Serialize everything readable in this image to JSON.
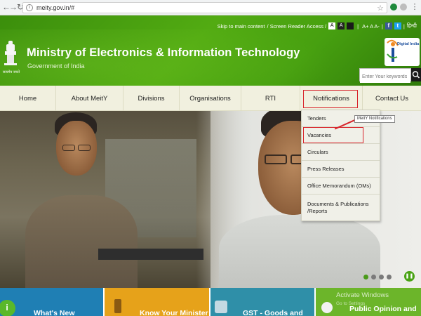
{
  "browser": {
    "url": "meity.gov.in/#",
    "back_icon": "back-arrow-icon",
    "forward_icon": "forward-arrow-icon",
    "reload_icon": "reload-icon"
  },
  "utility": {
    "skip_link": "Skip to main content",
    "screen_reader": "/ Screen Reader Access /",
    "contrast_a_light": "A",
    "contrast_a_dark": "A",
    "font_sizes": "A+ A A-",
    "hindi": "हिन्दी"
  },
  "header": {
    "title": "Ministry of Electronics & Information Technology",
    "subtitle": "Government of India",
    "emblem_caption": "सत्यमेव जयते",
    "logo_text": "Digital India"
  },
  "search": {
    "placeholder": "Enter Your keywords"
  },
  "nav": {
    "items": [
      "Home",
      "About MeitY",
      "Divisions",
      "Organisations",
      "RTI",
      "Notifications",
      "Contact Us"
    ]
  },
  "dropdown": {
    "items": [
      "Tenders",
      "Vacancies",
      "Circulars",
      "Press Releases",
      "Office Memorandum (OMs)",
      "Documents & Publications /Reports"
    ],
    "tooltip": "MeitY Notifications"
  },
  "tiles": {
    "items": [
      "What's New",
      "Know Your Minister",
      "GST - Goods and",
      "Public Opinion and"
    ]
  },
  "watermark": {
    "line1": "Activate Windows",
    "line2": "Go to Settings"
  },
  "colors": {
    "header_green": "#47a010",
    "nav_bg": "#f1f0df",
    "highlight_red": "#d8232a",
    "tile_blue": "#1f7fb4",
    "tile_orange": "#e6a21a",
    "tile_teal": "#2f8fa8",
    "tile_green": "#6cb52a"
  }
}
